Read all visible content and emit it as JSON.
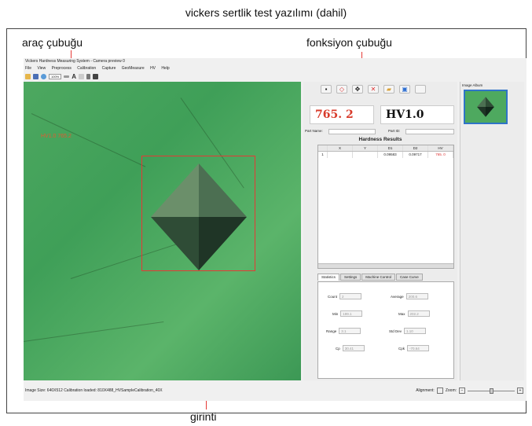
{
  "caption": "vickers sertlik test yazılımı (dahil)",
  "annotations": {
    "toolbar": "araç çubuğu",
    "function_bar": "fonksiyon çubuğu",
    "indentation": "girinti"
  },
  "app": {
    "title": "Vickers Hardness Measuring System - Camera preview 0",
    "menu": [
      "File",
      "View",
      "Preprocess",
      "Calibration",
      "Capture",
      "GeoMeasure",
      "HV",
      "Help"
    ],
    "zoom_value": "100%",
    "toolbar_text_icon": "A"
  },
  "image_overlay": {
    "label": "HV1.0  765.2"
  },
  "results": {
    "hv_value": "765. 2",
    "hv_scale": "HV1.0",
    "part_name_label": "Part Name:",
    "part_id_label": "Part ID:",
    "title": "Hardness Results",
    "columns": [
      "",
      "X",
      "Y",
      "D1",
      "D2",
      "HV"
    ],
    "rows": [
      [
        "1",
        "",
        "",
        "0.09583",
        "0.09717",
        "765. 0"
      ]
    ]
  },
  "tabs": [
    "Statistics",
    "Settings",
    "Machine Control",
    "Case Curve"
  ],
  "statistics": {
    "count_label": "Count",
    "count": "2",
    "average_label": "Average",
    "average": "200.6",
    "min_label": "Min",
    "min": "199.1",
    "max_label": "Max",
    "max": "202.2",
    "range_label": "Range",
    "range": "3.1",
    "stddev_label": "Std Dev",
    "stddev": "1.10",
    "cp_label": "Cp",
    "cp": "30.41",
    "cpk_label": "Cpk",
    "cpk": "-70.64"
  },
  "album": {
    "title": "Image Album"
  },
  "status": {
    "left": "Image Size: 640X512  Calibration loaded: 810X488_HVSampleCalibration_40X",
    "alignment_label": "Alignment:",
    "zoom_label": "Zoom:"
  },
  "colors": {
    "accent_red": "#e53935",
    "sample_green": "#4da860"
  }
}
